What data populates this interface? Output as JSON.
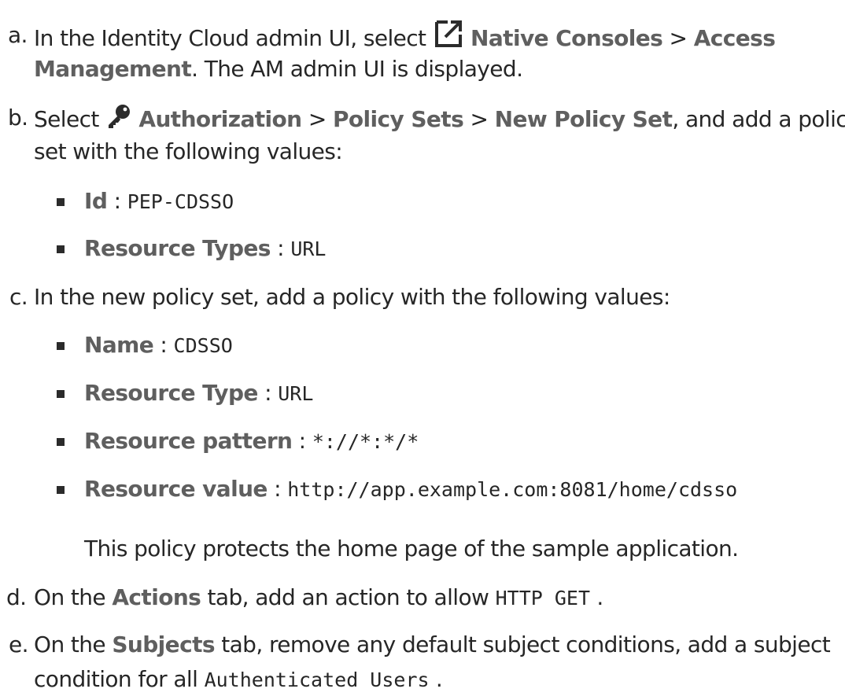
{
  "steps": {
    "a": {
      "marker": "a.",
      "line1_pre": "In the Identity Cloud admin UI, select ",
      "icon": "external-link-icon",
      "native_consoles": "Native Consoles",
      "sep1": " > ",
      "access": "Access",
      "management": "Management",
      "line2_post": ". The AM admin UI is displayed."
    },
    "b": {
      "marker": "b.",
      "pre": "Select ",
      "icon": "key-icon",
      "authorization": "Authorization",
      "sep1": " > ",
      "policy_sets": "Policy Sets",
      "sep2": " > ",
      "new_policy_set": "New Policy Set",
      "post": ", and add a policy",
      "line2": "set with the following values:",
      "items": [
        {
          "label": "Id",
          "sep": " : ",
          "value": "PEP-CDSSO"
        },
        {
          "label": "Resource Types",
          "sep": " : ",
          "value": "URL"
        }
      ]
    },
    "c": {
      "marker": "c.",
      "text": "In the new policy set, add a policy with the following values:",
      "items": [
        {
          "label": "Name",
          "sep": " : ",
          "value": "CDSSO"
        },
        {
          "label": "Resource Type",
          "sep": " : ",
          "value": "URL"
        },
        {
          "label": "Resource pattern",
          "sep": " : ",
          "value": "*://*:*/*"
        },
        {
          "label": "Resource value",
          "sep": " : ",
          "value": "http://app.example.com:8081/home/cdsso"
        }
      ],
      "note": "This policy protects the home page of the sample application."
    },
    "d": {
      "marker": "d.",
      "pre": "On the ",
      "bold": "Actions",
      "mid": " tab, add an action to allow ",
      "code": "HTTP GET",
      "post": " ."
    },
    "e": {
      "marker": "e.",
      "pre": "On the ",
      "bold": "Subjects",
      "mid": " tab, remove any default subject conditions, add a subject",
      "line2_pre": "condition for all ",
      "code": "Authenticated Users",
      "post": " ."
    }
  }
}
